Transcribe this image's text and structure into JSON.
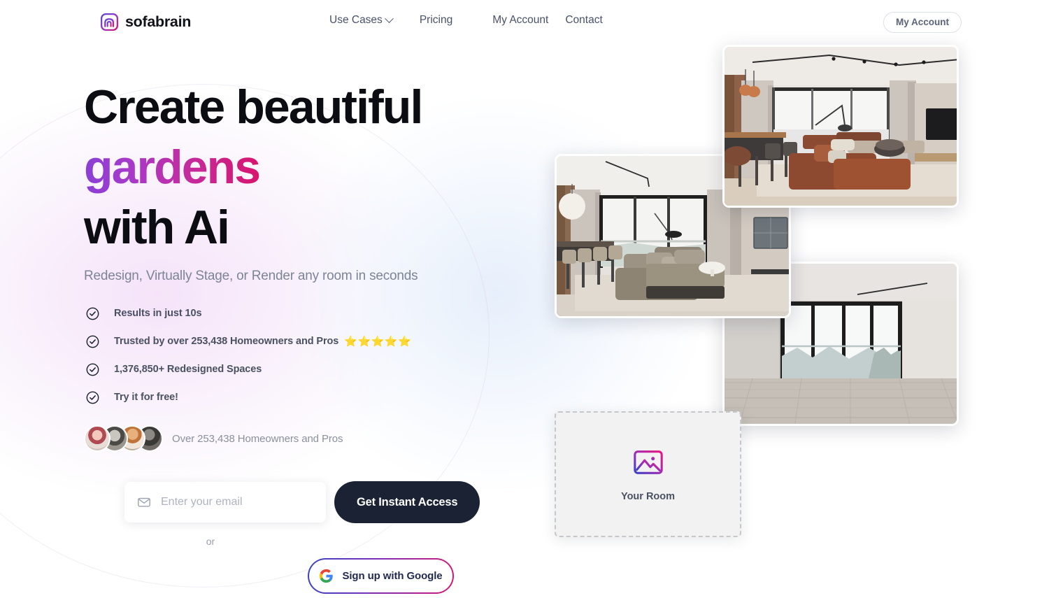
{
  "header": {
    "logo_text": "sofabrain",
    "logo_icon": "sofa-arch-logo-icon",
    "nav": [
      {
        "label": "Use Cases",
        "has_dropdown": true,
        "icon": "chevron-down-icon"
      },
      {
        "label": "Pricing",
        "has_dropdown": false
      },
      {
        "label": "My Account",
        "has_dropdown": false
      },
      {
        "label": "Contact",
        "has_dropdown": false
      }
    ],
    "account_button_label": "My Account"
  },
  "hero": {
    "headline_line1": "Create beautiful",
    "headline_line2": "gardens",
    "headline_line3": "with Ai",
    "subheadline": "Redesign, Virtually Stage, or Render any room in seconds",
    "features": [
      {
        "text": "Results in just 10s",
        "icon": "check-circle-icon",
        "stars": ""
      },
      {
        "text": "Trusted by over 253,438 Homeowners and Pros",
        "icon": "check-circle-icon",
        "stars": "⭐⭐⭐⭐⭐"
      },
      {
        "text": "1,376,850+ Redesigned Spaces",
        "icon": "check-circle-icon",
        "stars": ""
      },
      {
        "text": "Try it for free!",
        "icon": "check-circle-icon",
        "stars": ""
      }
    ],
    "social_proof_text": "Over 253,438 Homeowners and Pros",
    "avatar_count": 4
  },
  "signup": {
    "email_placeholder": "Enter your email",
    "email_value": "",
    "email_icon": "envelope-icon",
    "cta_label": "Get Instant Access",
    "divider_label": "or",
    "google_label": "Sign up with Google",
    "google_icon": "google-g-icon"
  },
  "gallery": {
    "images": [
      {
        "name": "living-room-brown-leather-sofa",
        "alt": "Modern living room with brown leather sectional, TV and track lighting"
      },
      {
        "name": "living-room-beige-sectional",
        "alt": "Bright living room with beige sectional, globe pendant lamp and city view"
      },
      {
        "name": "empty-room-wood-floor",
        "alt": "Empty room with wood floor and floor-to-ceiling windows with mountain view"
      }
    ]
  },
  "upload": {
    "label": "Your Room",
    "icon": "image-placeholder-icon"
  },
  "colors": {
    "gradient_start": "#8a3fd6",
    "gradient_end": "#d8156d",
    "cta_background": "#1a2233",
    "star_color": "#fbbf24",
    "text_dark": "#0c0d12",
    "text_muted": "#7c8496"
  }
}
